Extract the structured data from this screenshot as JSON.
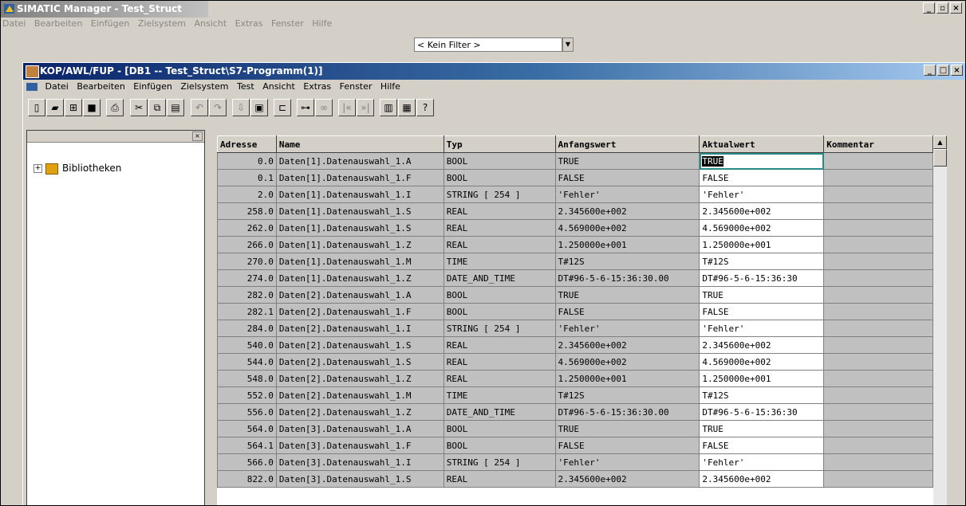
{
  "outer_window": {
    "title": "SIMATIC Manager - Test_Struct",
    "menu": [
      "Datei",
      "Bearbeiten",
      "Einfügen",
      "Zielsystem",
      "Ansicht",
      "Extras",
      "Fenster",
      "Hilfe"
    ],
    "filter_value": "< Kein Filter >"
  },
  "inner_window": {
    "title": "KOP/AWL/FUP - [DB1 -- Test_Struct\\S7-Programm(1)]",
    "menu": [
      "Datei",
      "Bearbeiten",
      "Einfügen",
      "Zielsystem",
      "Test",
      "Ansicht",
      "Extras",
      "Fenster",
      "Hilfe"
    ]
  },
  "tree": {
    "item": "Bibliotheken"
  },
  "table": {
    "headers": [
      "Adresse",
      "Name",
      "Typ",
      "Anfangswert",
      "Aktualwert",
      "Kommentar"
    ],
    "rows": [
      [
        "0.0",
        "Daten[1].Datenauswahl_1.A",
        "BOOL",
        "TRUE",
        "TRUE",
        ""
      ],
      [
        "0.1",
        "Daten[1].Datenauswahl_1.F",
        "BOOL",
        "FALSE",
        "FALSE",
        ""
      ],
      [
        "2.0",
        "Daten[1].Datenauswahl_1.I",
        "STRING [ 254 ]",
        "'Fehler'",
        "'Fehler'",
        ""
      ],
      [
        "258.0",
        "Daten[1].Datenauswahl_1.S",
        "REAL",
        "2.345600e+002",
        "2.345600e+002",
        ""
      ],
      [
        "262.0",
        "Daten[1].Datenauswahl_1.S",
        "REAL",
        "4.569000e+002",
        "4.569000e+002",
        ""
      ],
      [
        "266.0",
        "Daten[1].Datenauswahl_1.Z",
        "REAL",
        "1.250000e+001",
        "1.250000e+001",
        ""
      ],
      [
        "270.0",
        "Daten[1].Datenauswahl_1.M",
        "TIME",
        "T#12S",
        "T#12S",
        ""
      ],
      [
        "274.0",
        "Daten[1].Datenauswahl_1.Z",
        "DATE_AND_TIME",
        "DT#96-5-6-15:36:30.00",
        "DT#96-5-6-15:36:30",
        ""
      ],
      [
        "282.0",
        "Daten[2].Datenauswahl_1.A",
        "BOOL",
        "TRUE",
        "TRUE",
        ""
      ],
      [
        "282.1",
        "Daten[2].Datenauswahl_1.F",
        "BOOL",
        "FALSE",
        "FALSE",
        ""
      ],
      [
        "284.0",
        "Daten[2].Datenauswahl_1.I",
        "STRING [ 254 ]",
        "'Fehler'",
        "'Fehler'",
        ""
      ],
      [
        "540.0",
        "Daten[2].Datenauswahl_1.S",
        "REAL",
        "2.345600e+002",
        "2.345600e+002",
        ""
      ],
      [
        "544.0",
        "Daten[2].Datenauswahl_1.S",
        "REAL",
        "4.569000e+002",
        "4.569000e+002",
        ""
      ],
      [
        "548.0",
        "Daten[2].Datenauswahl_1.Z",
        "REAL",
        "1.250000e+001",
        "1.250000e+001",
        ""
      ],
      [
        "552.0",
        "Daten[2].Datenauswahl_1.M",
        "TIME",
        "T#12S",
        "T#12S",
        ""
      ],
      [
        "556.0",
        "Daten[2].Datenauswahl_1.Z",
        "DATE_AND_TIME",
        "DT#96-5-6-15:36:30.00",
        "DT#96-5-6-15:36:30",
        ""
      ],
      [
        "564.0",
        "Daten[3].Datenauswahl_1.A",
        "BOOL",
        "TRUE",
        "TRUE",
        ""
      ],
      [
        "564.1",
        "Daten[3].Datenauswahl_1.F",
        "BOOL",
        "FALSE",
        "FALSE",
        ""
      ],
      [
        "566.0",
        "Daten[3].Datenauswahl_1.I",
        "STRING [ 254 ]",
        "'Fehler'",
        "'Fehler'",
        ""
      ],
      [
        "822.0",
        "Daten[3].Datenauswahl_1.S",
        "REAL",
        "2.345600e+002",
        "2.345600e+002",
        ""
      ]
    ]
  }
}
